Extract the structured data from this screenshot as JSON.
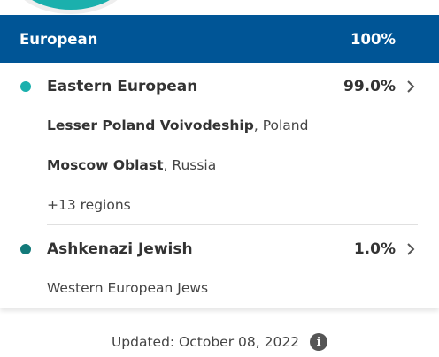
{
  "header": {
    "title": "European",
    "percent": "100%"
  },
  "categories": [
    {
      "name": "Eastern European",
      "percent": "99.0%",
      "color": "#1bb0ad",
      "regions": [
        {
          "name": "Lesser Poland Voivodeship",
          "country": ", Poland"
        },
        {
          "name": "Moscow Oblast",
          "country": ", Russia"
        }
      ],
      "more": "+13 regions"
    },
    {
      "name": "Ashkenazi Jewish",
      "percent": "1.0%",
      "color": "#137a7a",
      "subtext": "Western European Jews"
    }
  ],
  "footer": {
    "updated": "Updated: October 08, 2022",
    "icon": "info-icon"
  }
}
